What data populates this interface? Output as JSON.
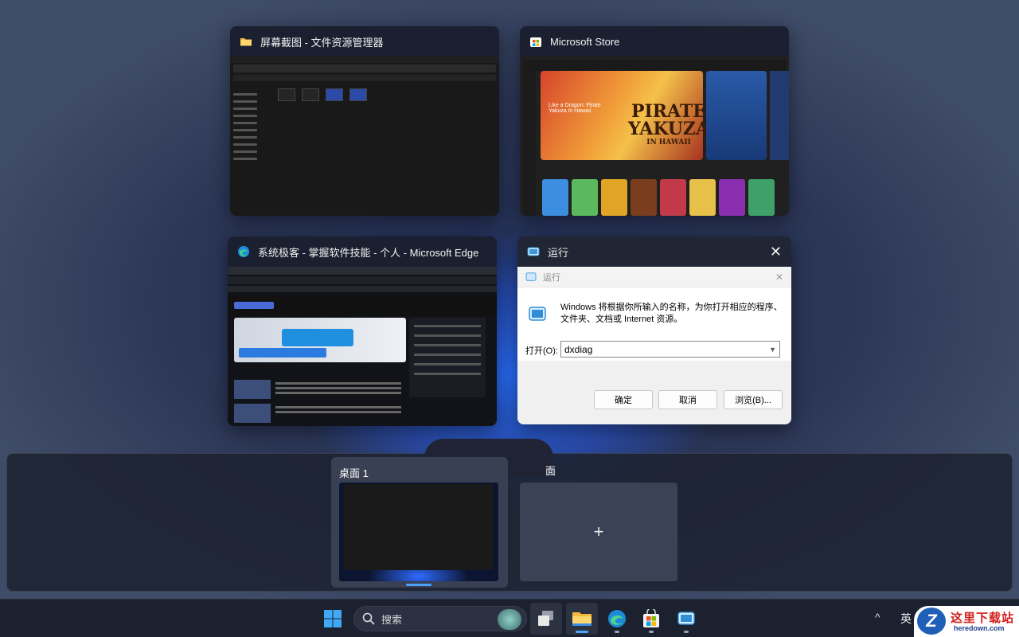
{
  "task_view": {
    "windows": [
      {
        "title": "屏幕截图 - 文件资源管理器",
        "app": "File Explorer",
        "icon": "folder-icon"
      },
      {
        "title": "Microsoft Store",
        "app": "Microsoft Store",
        "icon": "store-icon",
        "thumb": {
          "hero_title": "PIRATE YAKUZA",
          "hero_subtitle": "IN HAWAII",
          "hero_text": "Like a Dragon: Pirate Yakuza in Hawaii"
        }
      },
      {
        "title": "系统极客 - 掌握软件技能 - 个人 - Microsoft Edge",
        "app": "Microsoft Edge",
        "icon": "edge-icon"
      },
      {
        "title": "运行",
        "app": "Run",
        "icon": "run-icon"
      }
    ],
    "run_dialog": {
      "bar_title": "运行",
      "message": "Windows 将根据你所输入的名称，为你打开相应的程序、文件夹、文档或 Internet 资源。",
      "open_label": "打开(O):",
      "input_value": "dxdiag",
      "ok": "确定",
      "cancel": "取消",
      "browse": "浏览(B)..."
    }
  },
  "desktops": {
    "items": [
      {
        "label": "桌面 1",
        "active": true
      }
    ],
    "new_desktop_label": "面",
    "new_desktop_glyph": "+"
  },
  "taskbar": {
    "search_placeholder": "搜索",
    "tray_chevron": "^",
    "language": "英",
    "pinned": [
      "task-view-icon",
      "file-explorer-icon",
      "edge-icon",
      "store-icon",
      "run-icon"
    ]
  },
  "watermark": {
    "title": "这里下载站",
    "subtitle": "heredown.com"
  },
  "colors": {
    "accent": "#4aa3ff",
    "taskbar_bg": "#1c2130",
    "glow": "#2f6bff"
  }
}
